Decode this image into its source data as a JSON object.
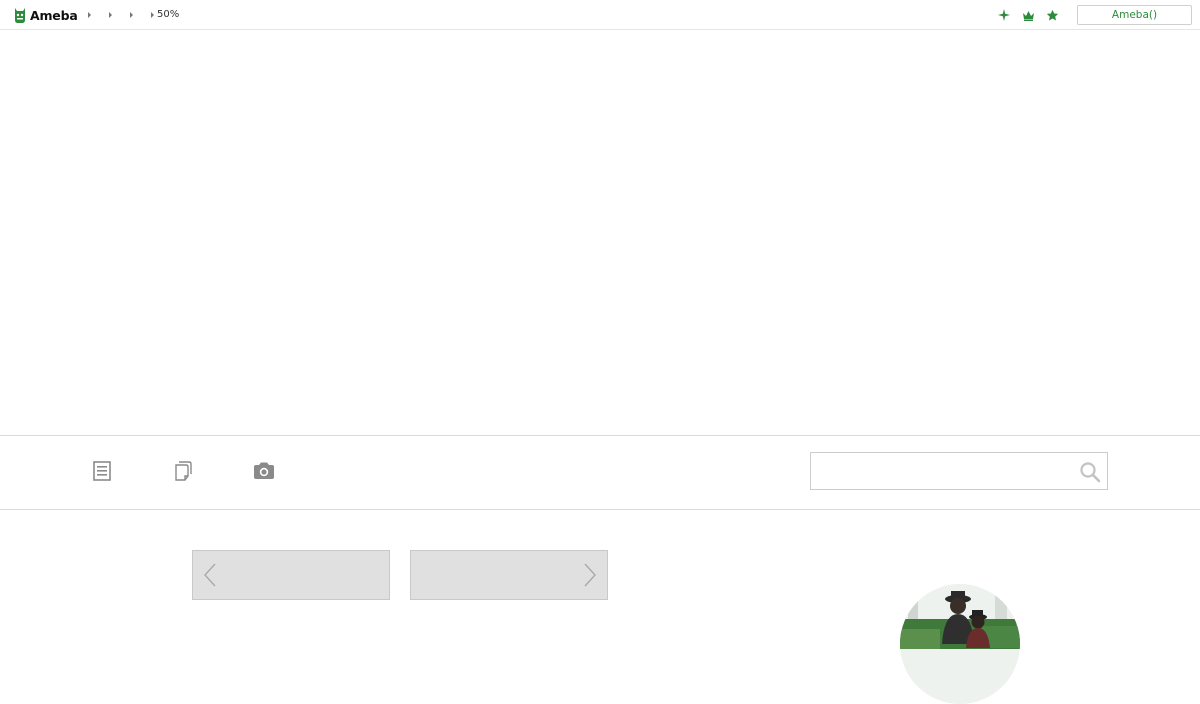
{
  "topbar": {
    "logo_text": "Ameba",
    "breadcrumb": [
      "",
      "",
      "",
      "50%"
    ],
    "icons": [
      "sparkle-icon",
      "crown-icon",
      "star-icon"
    ],
    "login_label": "Ameba()",
    "accent_color": "#2d8c3c"
  },
  "nav": {
    "icons": [
      "article-list-icon",
      "copy-pages-icon",
      "camera-icon"
    ],
    "search": {
      "value": "",
      "placeholder": ""
    }
  },
  "pager": {
    "prev_icon": "chevron-left-icon",
    "next_icon": "chevron-right-icon"
  },
  "profile": {
    "avatar": "profile-photo"
  }
}
